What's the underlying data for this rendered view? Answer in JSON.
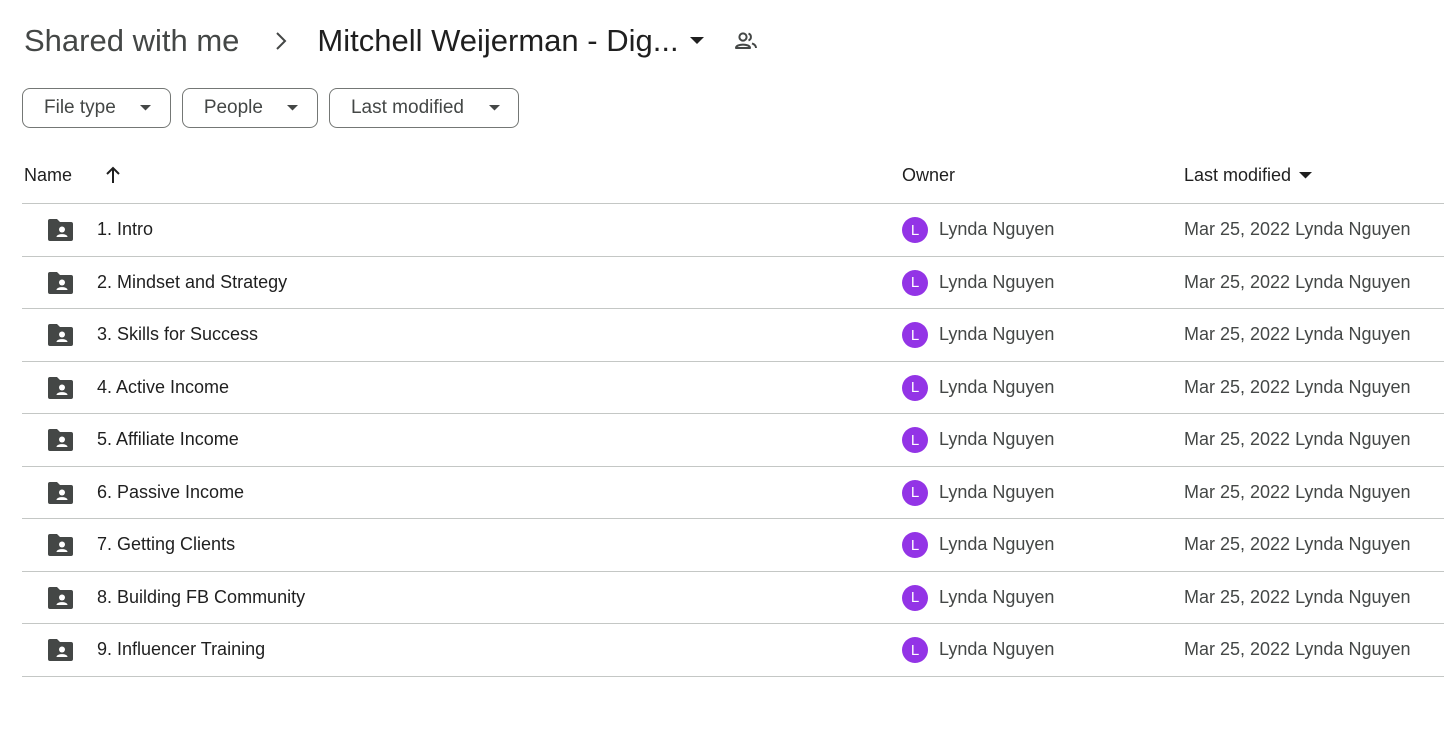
{
  "breadcrumb": {
    "root": "Shared with me",
    "current": "Mitchell Weijerman - Dig..."
  },
  "filters": [
    {
      "label": "File type"
    },
    {
      "label": "People"
    },
    {
      "label": "Last modified"
    }
  ],
  "table": {
    "headers": {
      "name": "Name",
      "owner": "Owner",
      "last_modified": "Last modified"
    },
    "rows": [
      {
        "name": "1. Intro",
        "owner_initial": "L",
        "owner": "Lynda Nguyen",
        "modified": "Mar 25, 2022 Lynda Nguyen"
      },
      {
        "name": "2. Mindset and Strategy",
        "owner_initial": "L",
        "owner": "Lynda Nguyen",
        "modified": "Mar 25, 2022 Lynda Nguyen"
      },
      {
        "name": "3. Skills for Success",
        "owner_initial": "L",
        "owner": "Lynda Nguyen",
        "modified": "Mar 25, 2022 Lynda Nguyen"
      },
      {
        "name": "4. Active Income",
        "owner_initial": "L",
        "owner": "Lynda Nguyen",
        "modified": "Mar 25, 2022 Lynda Nguyen"
      },
      {
        "name": "5. Affiliate Income",
        "owner_initial": "L",
        "owner": "Lynda Nguyen",
        "modified": "Mar 25, 2022 Lynda Nguyen"
      },
      {
        "name": "6. Passive Income",
        "owner_initial": "L",
        "owner": "Lynda Nguyen",
        "modified": "Mar 25, 2022 Lynda Nguyen"
      },
      {
        "name": "7. Getting Clients",
        "owner_initial": "L",
        "owner": "Lynda Nguyen",
        "modified": "Mar 25, 2022 Lynda Nguyen"
      },
      {
        "name": "8. Building FB Community",
        "owner_initial": "L",
        "owner": "Lynda Nguyen",
        "modified": "Mar 25, 2022 Lynda Nguyen"
      },
      {
        "name": "9. Influencer Training",
        "owner_initial": "L",
        "owner": "Lynda Nguyen",
        "modified": "Mar 25, 2022 Lynda Nguyen"
      }
    ]
  },
  "icons": {
    "separator": "chevron-right-icon",
    "folder": "shared-folder-icon",
    "share": "people-icon",
    "sort": "arrow-up-icon",
    "dropdown": "caret-down-icon"
  },
  "colors": {
    "avatar": "#9334e6",
    "folder_icon": "#444746",
    "divider": "#c4c7c5",
    "chip_border": "#747775"
  }
}
